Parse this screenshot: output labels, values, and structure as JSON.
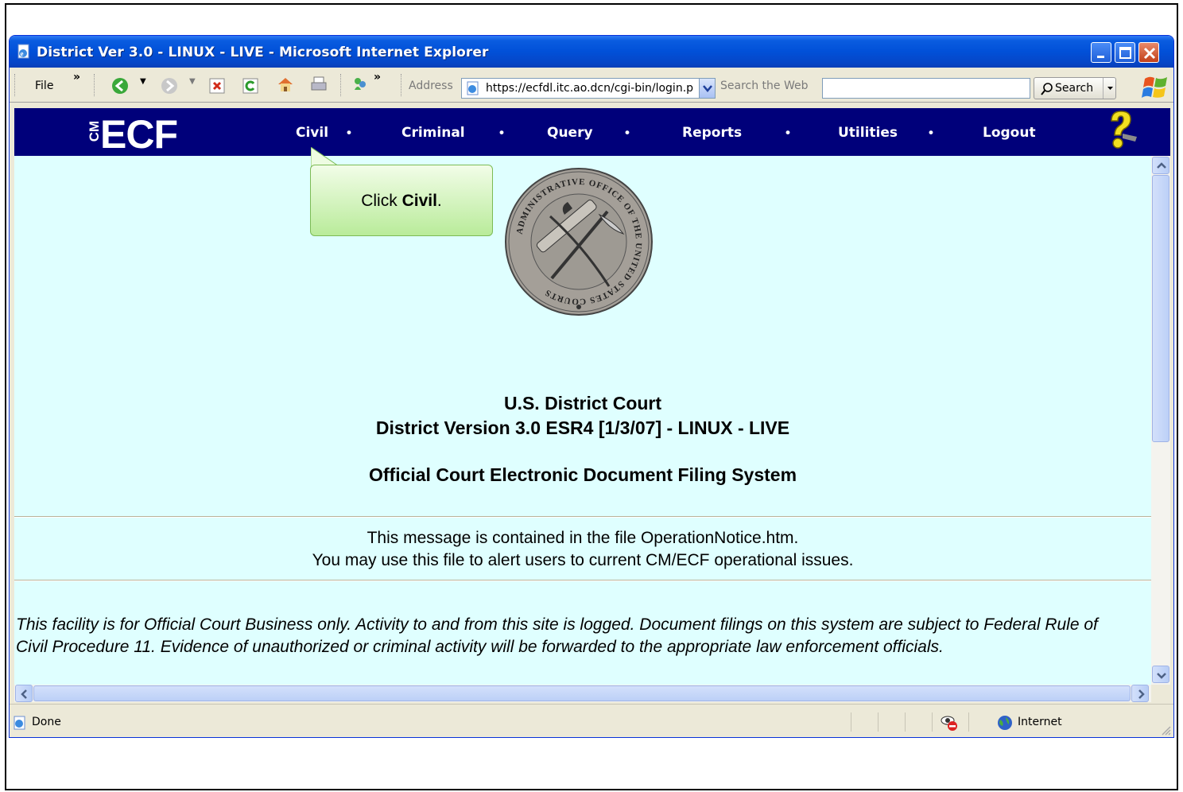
{
  "window": {
    "title": "District Ver 3.0 - LINUX - LIVE - Microsoft Internet Explorer"
  },
  "toolbar": {
    "file_label": "File",
    "chevron": "»",
    "address_label": "Address",
    "address_url": "https://ecfdl.itc.ao.dcn/cgi-bin/login.pl",
    "search_label": "Search the Web",
    "search_value": "",
    "search_button": "Search"
  },
  "ecf": {
    "logo_cm": "CM",
    "logo_ecf": "ECF",
    "nav": [
      "Civil",
      "Criminal",
      "Query",
      "Reports",
      "Utilities",
      "Logout"
    ],
    "dot": "•"
  },
  "callout": {
    "prefix": "Click ",
    "target": "Civil",
    "suffix": "."
  },
  "page": {
    "court": "U.S. District Court",
    "version": "District Version 3.0 ESR4 [1/3/07] - LINUX - LIVE",
    "system": "Official Court Electronic Document Filing System",
    "notice_line1": "This message is contained in the file OperationNotice.htm.",
    "notice_line2": "You may use this file to alert users to current CM/ECF operational issues.",
    "disclaimer": "This facility is for Official Court Business only. Activity to and from this site is logged. Document filings on this system are subject to Federal Rule of Civil Procedure 11. Evidence of unauthorized or criminal activity will be forwarded to the appropriate law enforcement officials."
  },
  "seal": {
    "text": "ADMINISTRATIVE OFFICE OF THE UNITED STATES COURTS"
  },
  "status": {
    "left": "Done",
    "zone": "Internet"
  },
  "colors": {
    "ecf_bar": "#00007a",
    "content_bg": "#dfffff",
    "callout_green": "#b9eb9a"
  }
}
